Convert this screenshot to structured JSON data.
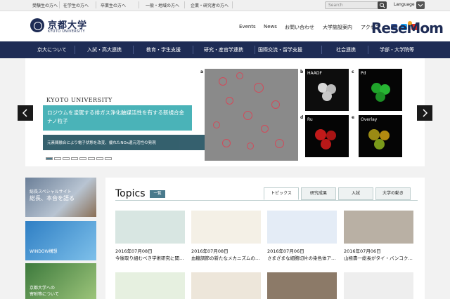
{
  "utility": {
    "links": [
      "受験生の方へ",
      "在学生の方へ",
      "卒業生の方へ",
      "一般・地域の方へ",
      "企業・研究者の方へ"
    ],
    "search_placeholder": "Search",
    "language_label": "Language"
  },
  "header": {
    "logo_jp": "京都大学",
    "logo_en": "KYOTO UNIVERSITY",
    "nav": [
      "Events",
      "News",
      "お問い合わせ",
      "大学施設案内",
      "アクセス"
    ],
    "brand": "ReseMom"
  },
  "main_nav": [
    "京大について",
    "入試・高大連携",
    "教育・学生支援",
    "研究・産官学連携",
    "国際交流・留学支援",
    "社会連携",
    "学部・大学院等"
  ],
  "hero": {
    "eyebrow": "KYOTO UNIVERSITY",
    "title": "ロジウムを凌駕する排ガス浄化触媒活性を有する新規合金ナノ粒子",
    "subtitle": "元素間融合により電子状態を改変、優れたNOx還元活性の発現",
    "figure": {
      "labels": [
        "a",
        "b",
        "c",
        "d",
        "e"
      ],
      "panel_titles": [
        "HAADF",
        "Pd",
        "Ru",
        "Overlay"
      ]
    }
  },
  "sidebar": [
    {
      "caption_line1": "総長スペシャルサイト",
      "caption_line2": "総長、本音を語る"
    },
    {
      "caption_line1": "WINDOW構想",
      "caption_line2": ""
    },
    {
      "caption_line1": "京都大学への",
      "caption_line2": "寄附等について"
    }
  ],
  "topics": {
    "title": "Topics",
    "all_label": "一覧",
    "tabs": [
      "トピックス",
      "研究成果",
      "入試",
      "大学の動き"
    ],
    "items": [
      {
        "date": "2016年07月08日",
        "text": "今後取り組むべき学術研究に関…"
      },
      {
        "date": "2016年07月08日",
        "text": "血糖調節の新たなメカニズムの…"
      },
      {
        "date": "2016年07月06日",
        "text": "さまざまな細胞切片の染色体ア…"
      },
      {
        "date": "2016年07月06日",
        "text": "山極壽一総長がタイ・バンコク…"
      }
    ]
  },
  "colors": {
    "navy": "#1e2c55",
    "teal": "#4ab3b8",
    "accent_orange": "#f5a623"
  }
}
